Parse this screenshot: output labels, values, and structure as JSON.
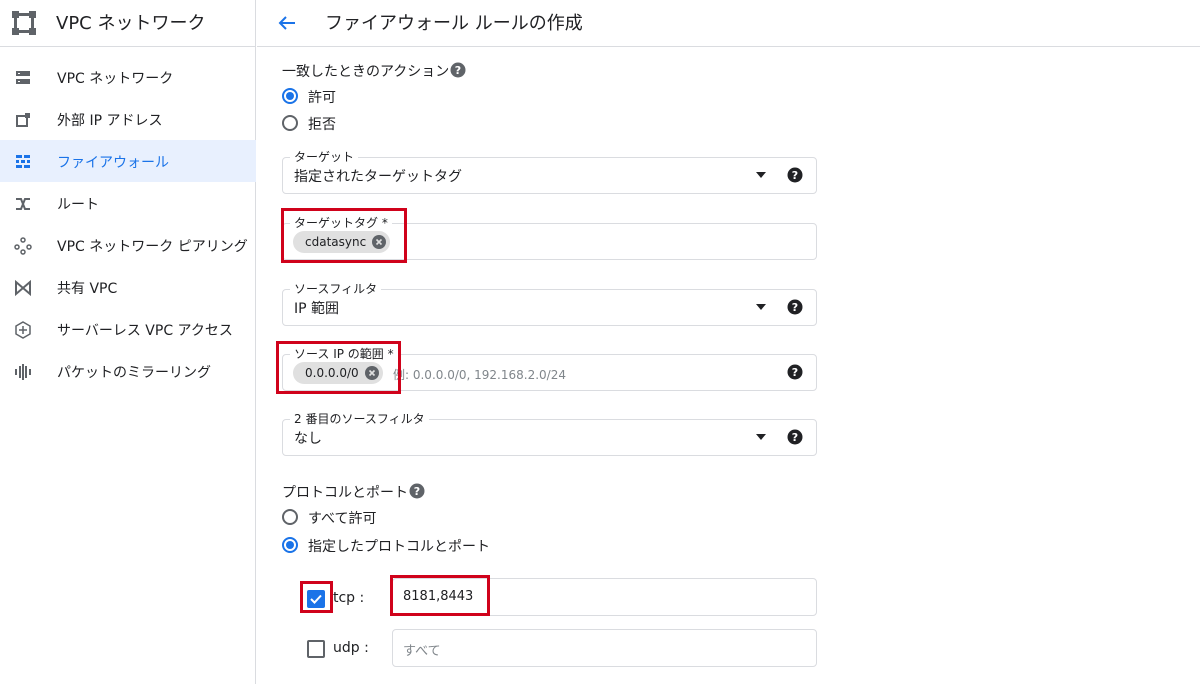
{
  "colors": {
    "accent": "#1a73e8",
    "highlight": "#d0021b",
    "active_bg": "#e8f0fe"
  },
  "sidebar": {
    "title": "VPC ネットワーク",
    "items": [
      {
        "label": "VPC ネットワーク",
        "icon": "vpc-network-icon"
      },
      {
        "label": "外部 IP アドレス",
        "icon": "external-ip-icon"
      },
      {
        "label": "ファイアウォール",
        "icon": "firewall-icon",
        "active": true
      },
      {
        "label": "ルート",
        "icon": "route-icon"
      },
      {
        "label": "VPC ネットワーク ピアリング",
        "icon": "peering-icon"
      },
      {
        "label": "共有 VPC",
        "icon": "shared-vpc-icon"
      },
      {
        "label": "サーバーレス VPC アクセス",
        "icon": "serverless-icon"
      },
      {
        "label": "パケットのミラーリング",
        "icon": "packet-mirroring-icon"
      }
    ]
  },
  "header": {
    "title": "ファイアウォール ルールの作成"
  },
  "action": {
    "title": "一致したときのアクション",
    "options": [
      {
        "label": "許可",
        "selected": true
      },
      {
        "label": "拒否",
        "selected": false
      }
    ]
  },
  "target": {
    "label": "ターゲット",
    "value": "指定されたターゲットタグ"
  },
  "target_tags": {
    "label": "ターゲットタグ *",
    "chips": [
      "cdatasync"
    ]
  },
  "source_filter": {
    "label": "ソースフィルタ",
    "value": "IP 範囲"
  },
  "source_ip": {
    "label": "ソース IP の範囲 *",
    "chips": [
      "0.0.0.0/0"
    ],
    "hint": "例: 0.0.0.0/0, 192.168.2.0/24"
  },
  "second_filter": {
    "label": "2 番目のソースフィルタ",
    "value": "なし"
  },
  "protocols": {
    "title": "プロトコルとポート",
    "options": [
      {
        "label": "すべて許可",
        "selected": false
      },
      {
        "label": "指定したプロトコルとポート",
        "selected": true
      }
    ],
    "tcp": {
      "label": "tcp :",
      "checked": true,
      "value": "8181,8443"
    },
    "udp": {
      "label": "udp :",
      "checked": false,
      "placeholder": "すべて"
    }
  }
}
